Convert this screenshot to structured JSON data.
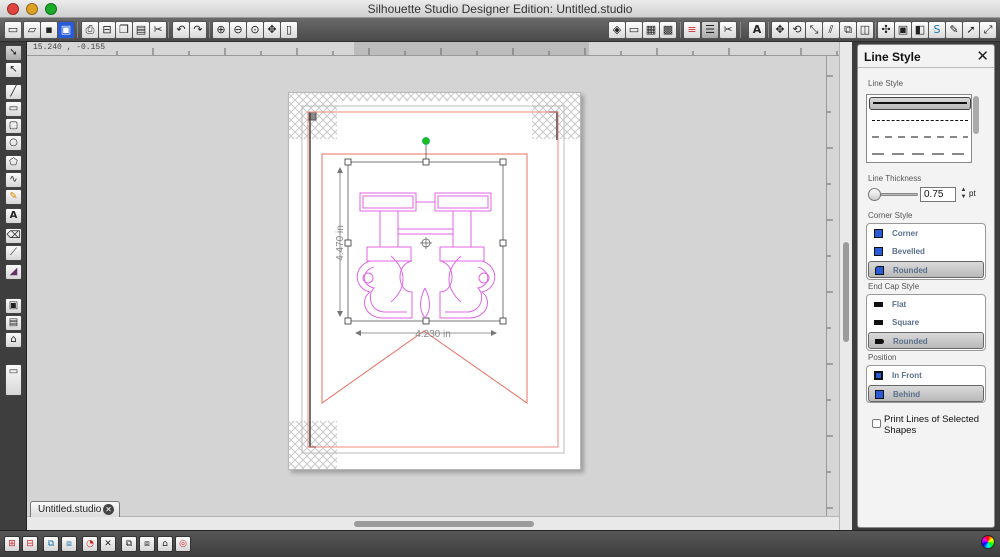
{
  "window": {
    "title": "Silhouette Studio Designer Edition: Untitled.studio"
  },
  "toolbar": {
    "file_icons": [
      "new-document-icon",
      "open-folder-icon",
      "save-icon",
      "save-to-library-icon",
      "print-icon",
      "print-cut-icon",
      "copy-icon",
      "paste-icon",
      "cut-scissors-icon"
    ],
    "history_icons": [
      "undo-icon",
      "redo-icon"
    ],
    "zoom_icons": [
      "zoom-in-icon",
      "zoom-out-icon",
      "zoom-select-icon",
      "pan-hand-icon",
      "fit-to-page-icon"
    ],
    "right_icons": [
      "fill-color-icon",
      "page-setup-icon",
      "registration-marks-icon",
      "grid-icon",
      "line-color-icon",
      "line-style-icon",
      "cut-style-icon",
      "text-style-icon",
      "transform-icon",
      "rotate-icon",
      "scale-icon",
      "shear-icon",
      "replicate-icon",
      "offset-icon",
      "modify-icon",
      "library-icon",
      "send-to-silhouette-icon",
      "store-icon",
      "edit-pencil-icon",
      "pointer-icon",
      "fullscreen-icon"
    ]
  },
  "left_tools": [
    "select-pointer-icon",
    "edit-points-icon",
    "line-tool-icon",
    "rectangle-tool-icon",
    "rounded-rect-tool-icon",
    "ellipse-tool-icon",
    "polygon-tool-icon",
    "curve-tool-icon",
    "freehand-tool-icon",
    "text-tool-icon",
    "eraser-tool-icon",
    "knife-tool-icon",
    "fill-paint-icon",
    "show-library-icon",
    "show-store-icon",
    "media-icon",
    "window-icon"
  ],
  "ruler": {
    "coordinates": "15.240 , -0.155"
  },
  "design": {
    "height_label": "4.470 in",
    "width_label": "4.230 in",
    "accent_pink": "#e066e6",
    "cut_line_red": "#e87060"
  },
  "document_tab": {
    "label": "Untitled.studio"
  },
  "line_style_panel": {
    "title": "Line Style",
    "line_style_label": "Line Style",
    "line_options": [
      "solid",
      "fine-dash",
      "medium-dash",
      "long-dash"
    ],
    "selected_line": "solid",
    "thickness_label": "Line Thickness",
    "thickness_value": "0.75",
    "thickness_unit": "pt",
    "corner_style_label": "Corner Style",
    "corner_options": [
      "Corner",
      "Bevelled",
      "Rounded"
    ],
    "corner_selected": "Rounded",
    "endcap_label": "End Cap Style",
    "endcap_options": [
      "Flat",
      "Square",
      "Rounded"
    ],
    "endcap_selected": "Rounded",
    "position_label": "Position",
    "position_options": [
      "In Front",
      "Behind"
    ],
    "position_selected": "Behind",
    "print_lines_label": "Print Lines of Selected Shapes"
  },
  "bottom_tools": [
    "group-icon",
    "ungroup-icon",
    "make-compound-icon",
    "release-compound-icon",
    "weld-icon",
    "knife-cut-icon",
    "bring-to-front-icon",
    "send-to-back-icon",
    "lock-icon",
    "target-icon"
  ]
}
